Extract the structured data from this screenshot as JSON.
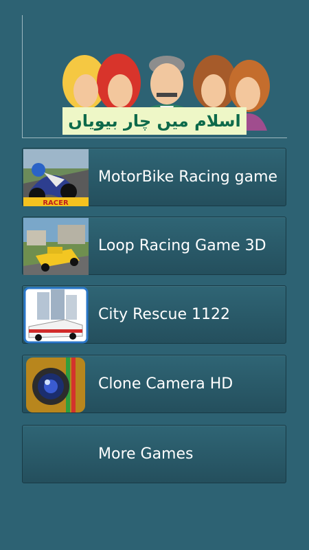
{
  "header": {
    "banner_text": "اسلام میں چار بیویاں"
  },
  "games": [
    {
      "label": "MotorBike Racing game",
      "thumb_text": "RACER"
    },
    {
      "label": "Loop Racing Game 3D"
    },
    {
      "label": "City Rescue 1122"
    },
    {
      "label": "Clone Camera HD"
    }
  ],
  "more": {
    "label": "More Games"
  }
}
